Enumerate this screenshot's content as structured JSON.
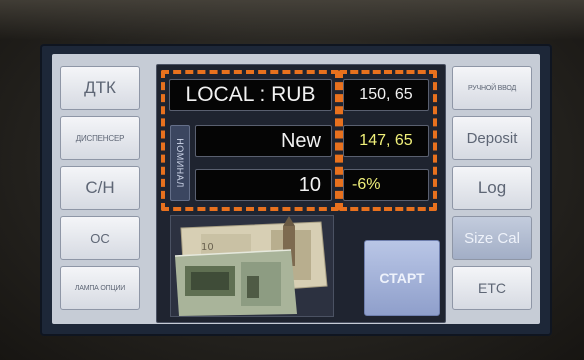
{
  "left_buttons": [
    {
      "label": "ДТК"
    },
    {
      "label": "ДИСПЕНСЕР"
    },
    {
      "label": "С/Н"
    },
    {
      "label": "ОС"
    },
    {
      "label": "ЛАМПА ОПЦИИ"
    }
  ],
  "right_buttons": [
    {
      "label": "РУЧНОЙ ВВОД"
    },
    {
      "label": "Deposit"
    },
    {
      "label": "Log"
    },
    {
      "label": "Size Cal"
    },
    {
      "label": "ETC"
    }
  ],
  "display": {
    "currency_mode": "LOCAL : RUB",
    "side_label": "НОМИНАЛ",
    "note_type": "New",
    "denomination": "10",
    "value_top": "150, 65",
    "value_mid": "147, 65",
    "value_diff": "-6%"
  },
  "start_button": {
    "label": "СТАРТ"
  },
  "colors": {
    "highlight": "#e8711e",
    "yellow_text": "#f0f07a",
    "size_cal_active": "#b2bdd2"
  },
  "icons": {
    "banknote_image": "banknote-photo-icon"
  }
}
